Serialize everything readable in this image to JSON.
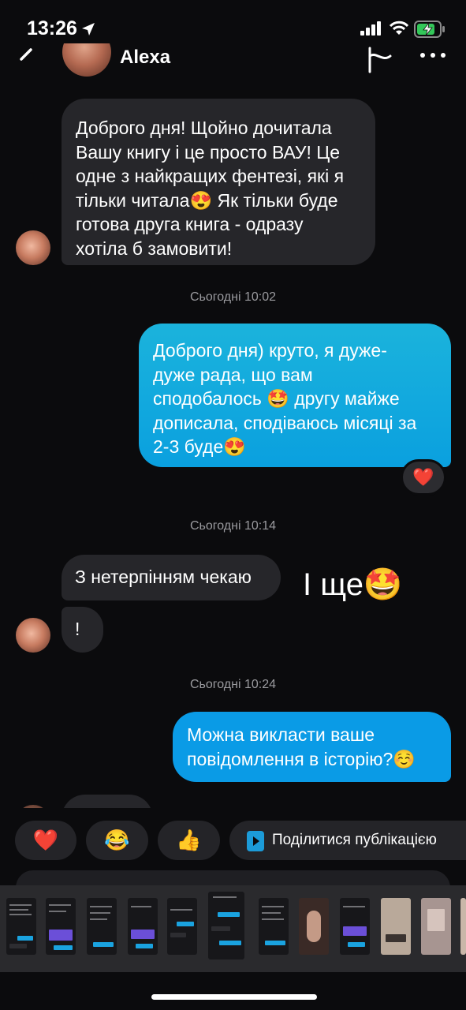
{
  "status_bar": {
    "time": "13:26",
    "icons": [
      "location-arrow-icon",
      "cellular-signal-icon",
      "wifi-icon",
      "battery-charging-icon"
    ]
  },
  "header": {
    "contact_name": "Alexa",
    "icons": [
      "back-chevron-icon",
      "flag-icon",
      "more-options-icon"
    ]
  },
  "messages": [
    {
      "direction": "in",
      "text": "Доброго дня! Щойно дочитала\nВашу книгу і це просто ВАУ! Це\nодне з найкращих фентезі, які я\nтільки читала😍 Як тільки буде\nготова друга книга - одразу\nхотіла б замовити!"
    },
    {
      "type": "timestamp",
      "text": "Сьогодні 10:02"
    },
    {
      "direction": "out",
      "text": "Доброго дня) круто, я дуже-\nдуже рада, що вам\nсподобалось 🤩 другу майже\nдописала, сподіваюсь місяці за\n2-3 буде😍",
      "reaction": "❤️"
    },
    {
      "type": "timestamp",
      "text": "Сьогодні 10:14"
    },
    {
      "direction": "in",
      "text": "З нетерпінням чекаю"
    },
    {
      "type": "overlay_text",
      "text": "І ще🤩"
    },
    {
      "direction": "in",
      "text": "!"
    },
    {
      "type": "timestamp",
      "text": "Сьогодні 10:24"
    },
    {
      "direction": "out",
      "text": "Можна викласти ваше\nповідомлення в історію?☺️"
    }
  ],
  "quick_replies": [
    {
      "emoji": "❤️",
      "name": "heart"
    },
    {
      "emoji": "😂",
      "name": "laughing"
    },
    {
      "emoji": "👍",
      "name": "thumbs-up"
    },
    {
      "label": "Поділитися публікацією",
      "icon": "play-icon"
    }
  ],
  "colors": {
    "background": "#0b0b0d",
    "incoming_bubble": "#26262a",
    "outgoing_bubble": "#0aa0df",
    "timestamp": "#9a9a9e",
    "chip": "#242428"
  }
}
